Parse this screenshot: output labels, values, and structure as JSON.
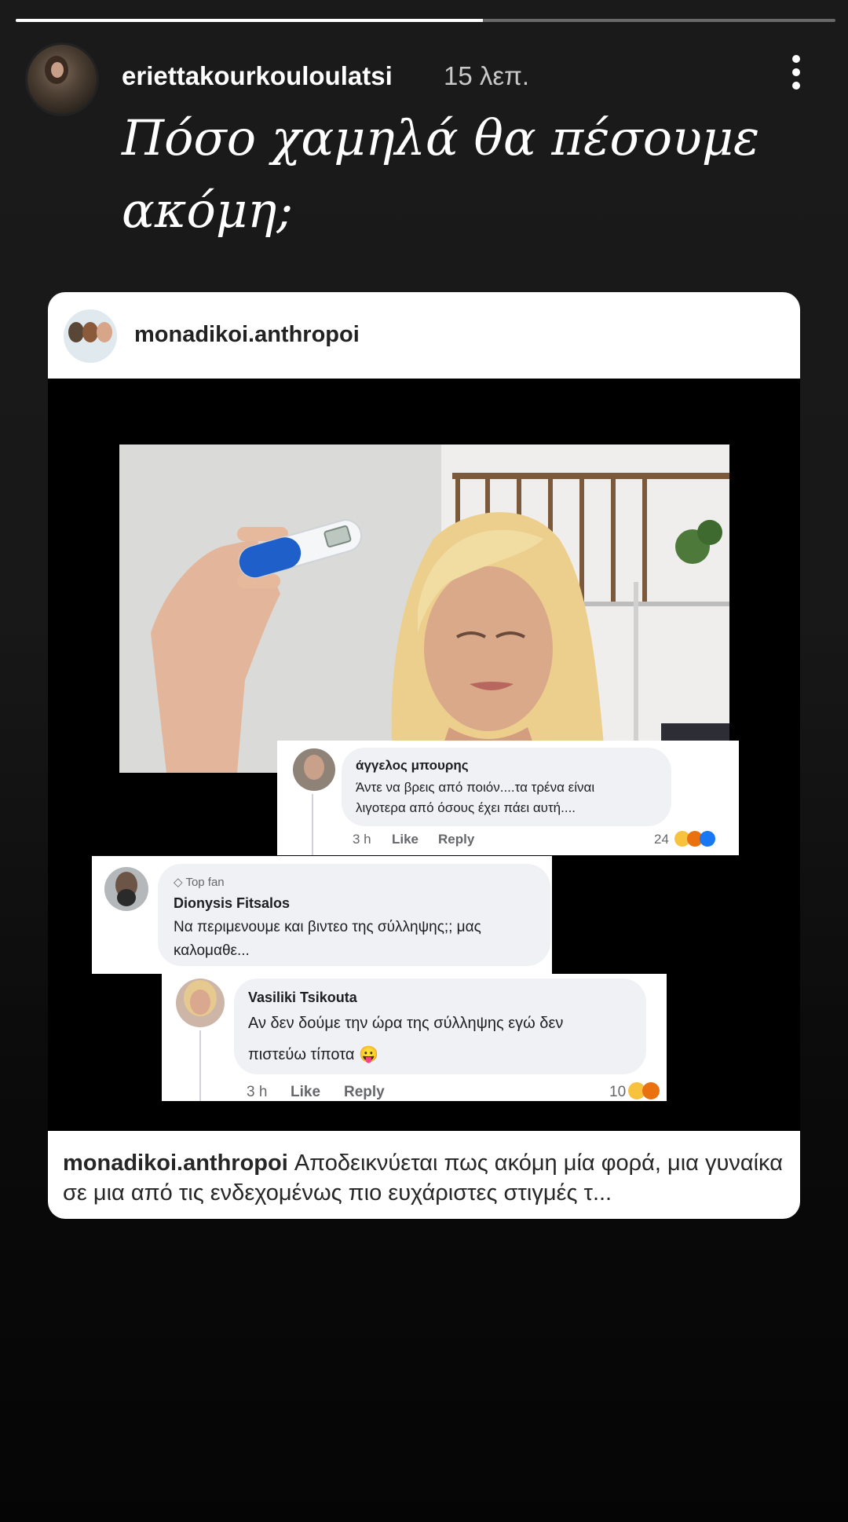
{
  "story": {
    "progress_fraction": 0.57,
    "username": "eriettakourkouloulatsi",
    "time_ago": "15 λεπ.",
    "caption": "Πόσο χαμηλά θα πέσουμε ακόμη;"
  },
  "post": {
    "username": "monadikoi.anthropoi",
    "caption_user": "monadikoi.anthropoi",
    "caption_text": "Αποδεικνύεται πως ακόμη μία φορά, μια γυναίκα  σε μια από τις ενδεχομένως πιο ευχάριστες στιγμές τ..."
  },
  "comments": [
    {
      "name": "άγγελος μπουρης",
      "text_line1": "Άντε να βρεις από ποιόν....τα τρένα είναι",
      "text_line2": "λιγοτερα από όσους έχει πάει αυτή....",
      "time": "3 h",
      "like": "Like",
      "reply": "Reply",
      "reactions": "24"
    },
    {
      "badge": "Top fan",
      "name": "Dionysis Fitsalos",
      "text_line1": "Να περιμενουμε και βιντεο της σύλληψης;; μας",
      "text_line2": "καλομαθε..."
    },
    {
      "name": "Vasiliki Tsikouta",
      "text_line1": "Αν δεν δούμε την ώρα της σύλληψης εγώ δεν",
      "text_line2": "πιστεύω τίποτα 😛",
      "time": "3 h",
      "like": "Like",
      "reply": "Reply",
      "reactions": "10"
    }
  ],
  "colors": {
    "background": "#0a0a0a",
    "bubble": "#eff1f4",
    "meta_text": "#65676b",
    "test_cap": "#1f5fc9"
  }
}
